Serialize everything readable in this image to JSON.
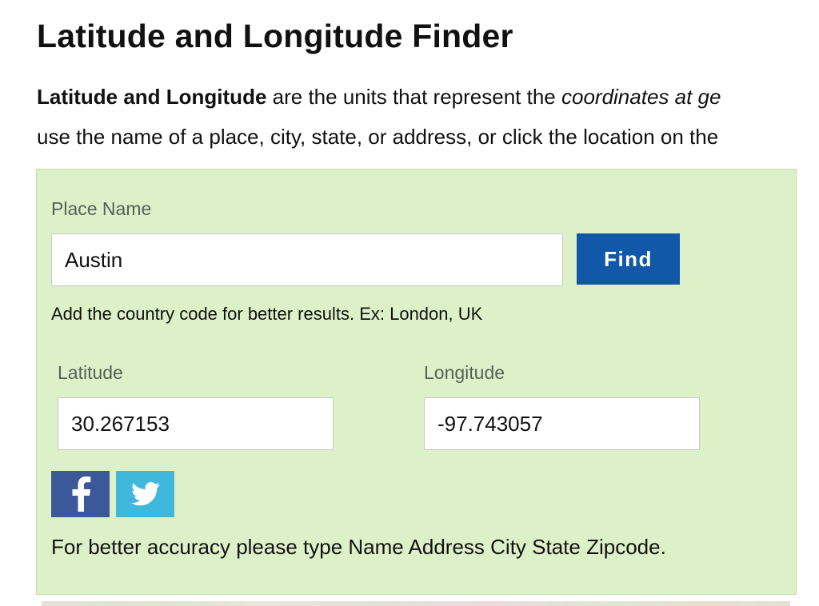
{
  "page": {
    "title": "Latitude and Longitude Finder",
    "intro": {
      "bold_lead": "Latitude and Longitude",
      "text_after_bold": " are the units that represent the ",
      "italic_text": "coordinates at ge",
      "line2": "use the name of a place, city, state, or address, or click the location on the"
    }
  },
  "finder": {
    "place_label": "Place Name",
    "place_value": "Austin",
    "find_label": "Find",
    "hint": "Add the country code for better results. Ex: London, UK",
    "latitude_label": "Latitude",
    "latitude_value": "30.267153",
    "longitude_label": "Longitude",
    "longitude_value": "-97.743057",
    "accuracy_note": "For better accuracy please type Name Address City State Zipcode."
  },
  "social": {
    "facebook_icon": "facebook-icon",
    "twitter_icon": "twitter-icon"
  },
  "colors": {
    "panel_bg": "#dcf1c8",
    "find_button": "#1158a8",
    "facebook": "#3b5998",
    "twitter": "#40b8dc"
  }
}
